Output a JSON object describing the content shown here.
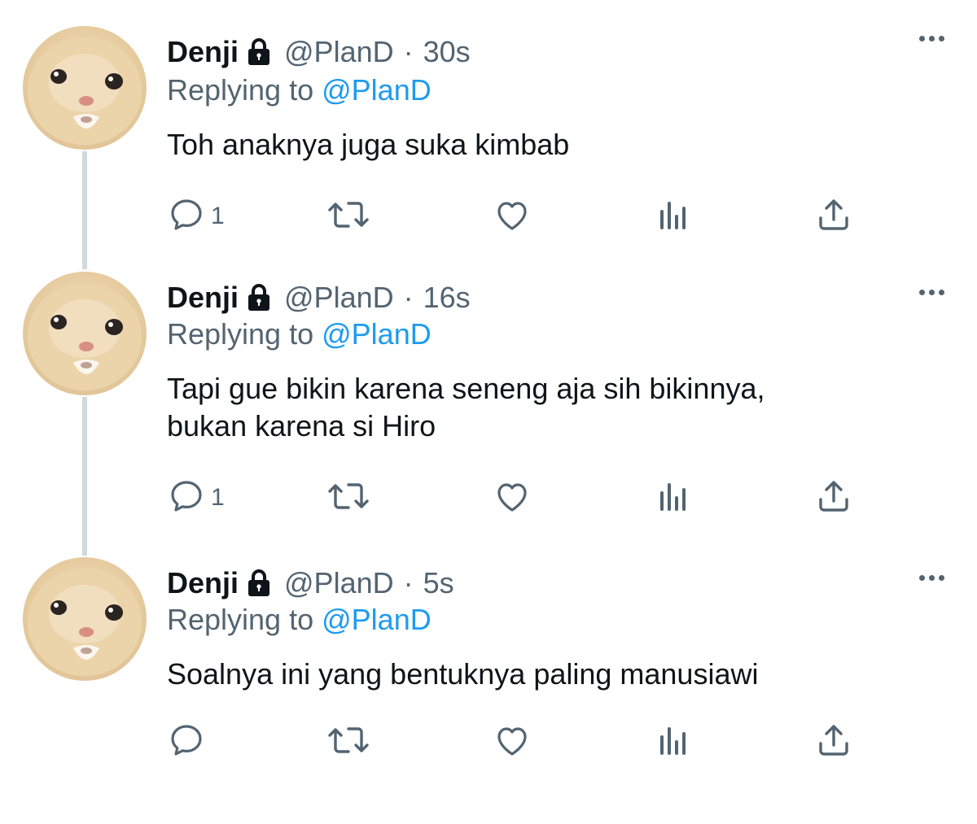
{
  "tweets": [
    {
      "name": "Denji",
      "handle": "@PlanD",
      "separator": "·",
      "time": "30s",
      "replying_prefix": "Replying to",
      "replying_handle": "@PlanD",
      "body_lines": [
        "Toh anaknya juga suka kimbab"
      ],
      "reply_count": "1"
    },
    {
      "name": "Denji",
      "handle": "@PlanD",
      "separator": "·",
      "time": "16s",
      "replying_prefix": "Replying to",
      "replying_handle": "@PlanD",
      "body_lines": [
        "Tapi gue bikin karena seneng aja sih bikinnya,",
        "bukan karena si Hiro"
      ],
      "reply_count": "1"
    },
    {
      "name": "Denji",
      "handle": "@PlanD",
      "separator": "·",
      "time": "5s",
      "replying_prefix": "Replying to",
      "replying_handle": "@PlanD",
      "body_lines": [
        "Soalnya ini yang bentuknya paling manusiawi"
      ],
      "reply_count": ""
    }
  ],
  "icons": {
    "lock": "lock-icon",
    "more": "more-icon",
    "reply": "reply-icon",
    "retweet": "retweet-icon",
    "like": "like-icon",
    "views": "views-icon",
    "share": "share-icon"
  },
  "colors": {
    "text": "#0f1419",
    "muted": "#536471",
    "link": "#1d9bf0",
    "thread_line": "#cfd9de"
  }
}
